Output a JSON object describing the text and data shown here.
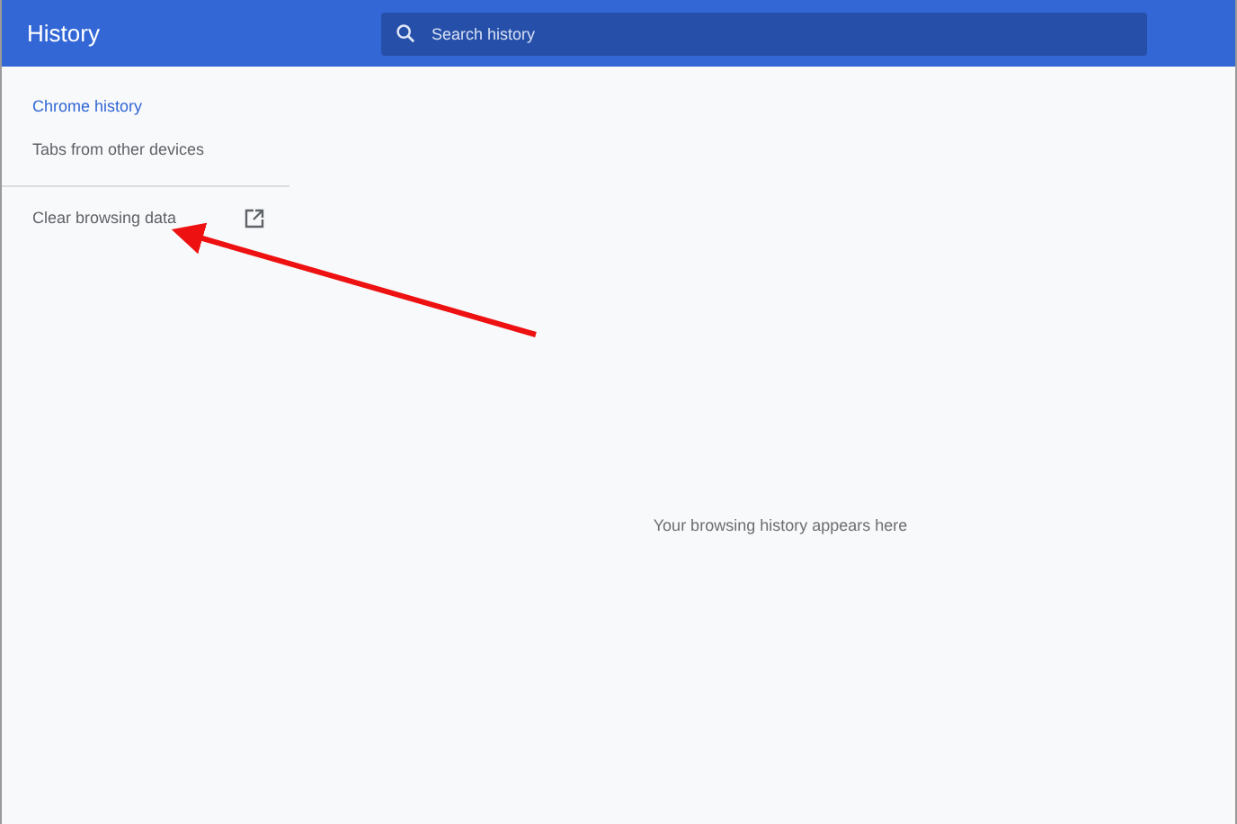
{
  "header": {
    "title": "History",
    "search": {
      "placeholder": "Search history"
    }
  },
  "sidebar": {
    "items": [
      {
        "label": "Chrome history",
        "selected": true
      },
      {
        "label": "Tabs from other devices",
        "selected": false
      }
    ],
    "footer_link": {
      "label": "Clear browsing data"
    }
  },
  "main": {
    "empty_message": "Your browsing history appears here"
  }
}
